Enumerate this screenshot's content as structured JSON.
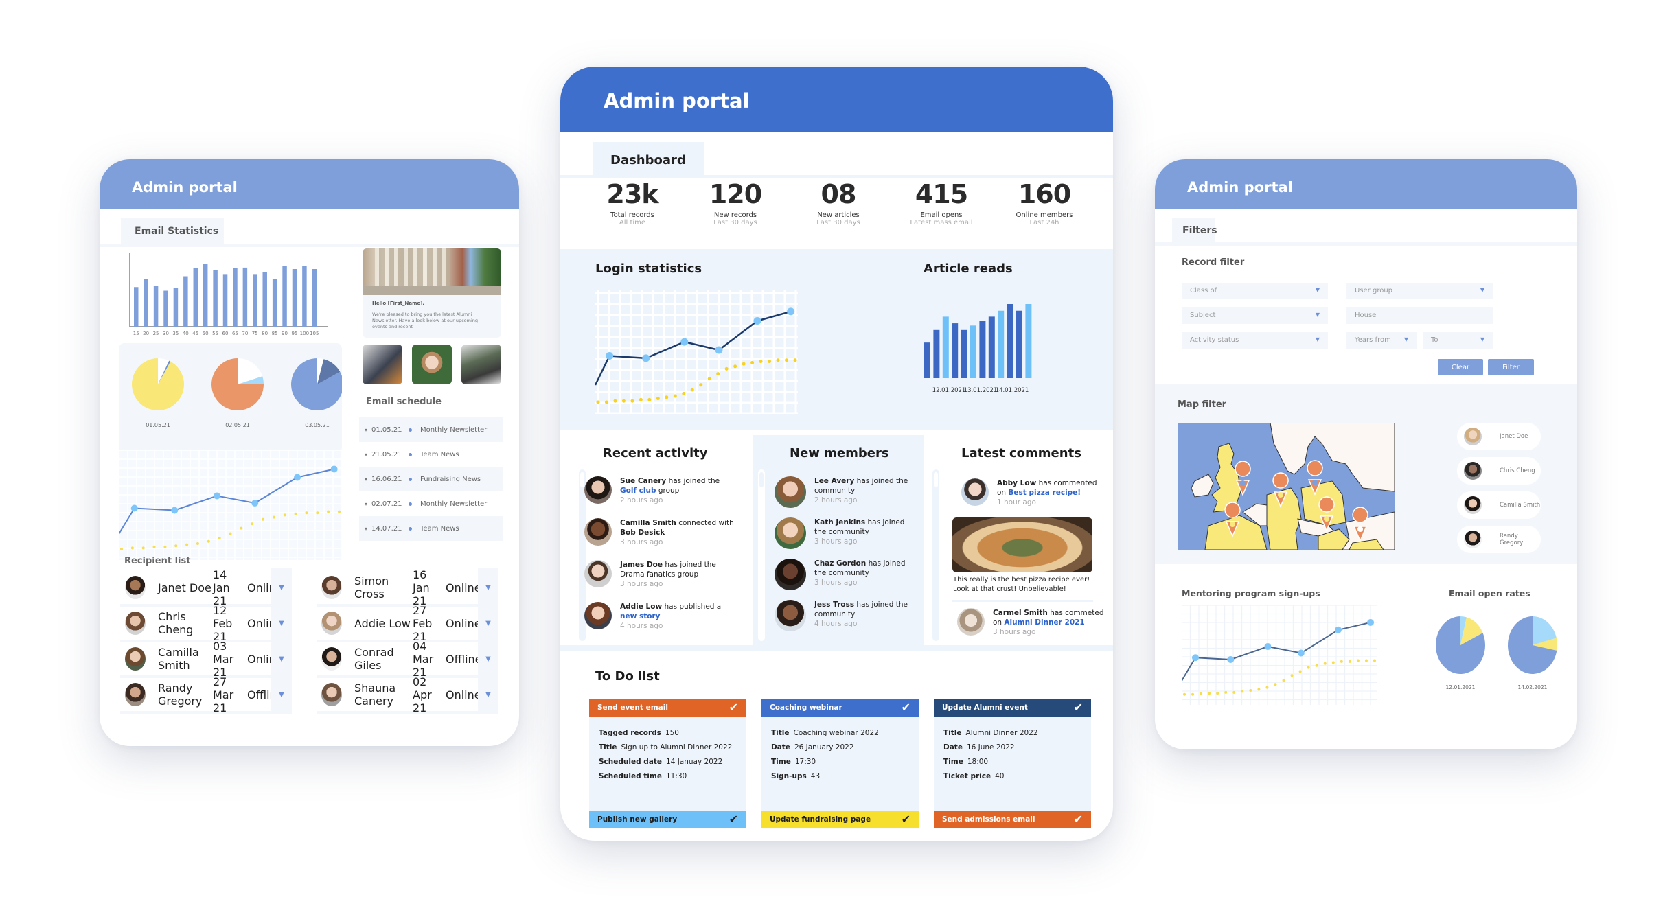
{
  "left": {
    "header_title": "Admin portal",
    "tab": "Email Statistics",
    "bar_chart": {
      "type": "bar",
      "categories": [
        "15",
        "20",
        "25",
        "30",
        "35",
        "40",
        "45",
        "50",
        "55",
        "60",
        "65",
        "70",
        "75",
        "80",
        "85",
        "90",
        "95",
        "100",
        "105"
      ],
      "values": [
        55,
        66,
        57,
        50,
        54,
        70,
        81,
        87,
        79,
        73,
        81,
        82,
        73,
        76,
        66,
        84,
        80,
        84,
        80
      ],
      "ylim": [
        0,
        100
      ]
    },
    "newsletter": {
      "greeting": "Hello [First_Name],",
      "body": "We're pleased to bring you the latest Alumni Newsletter. Have a look below at our upcoming events and recent"
    },
    "pies": [
      {
        "label": "01.05.21",
        "slices": [
          {
            "value": 92,
            "color": "#f9e777"
          },
          {
            "value": 1,
            "color": "#6b8fd8"
          },
          {
            "value": 7,
            "color": "#ffffff"
          }
        ]
      },
      {
        "label": "02.05.21",
        "slices": [
          {
            "value": 75,
            "color": "#ea9668"
          },
          {
            "value": 5,
            "color": "#a6dafa"
          },
          {
            "value": 20,
            "color": "#ffffff"
          }
        ]
      },
      {
        "label": "03.05.21",
        "slices": [
          {
            "value": 83,
            "color": "#7f9fdb"
          },
          {
            "value": 13,
            "color": "#5c77a8"
          },
          {
            "value": 4,
            "color": "#ffffff"
          }
        ]
      }
    ],
    "schedule_title": "Email schedule",
    "schedule": [
      {
        "date": "01.05.21",
        "name": "Monthly Newsletter"
      },
      {
        "date": "21.05.21",
        "name": "Team News"
      },
      {
        "date": "16.06.21",
        "name": "Fundraising News"
      },
      {
        "date": "02.07.21",
        "name": "Monthly Newsletter"
      },
      {
        "date": "14.07.21",
        "name": "Team News"
      }
    ],
    "line_chart": {
      "type": "line",
      "series": [
        {
          "name": "main",
          "values": [
            20,
            45,
            43,
            57,
            50,
            75,
            83
          ],
          "color": "#5b85d6"
        },
        {
          "name": "trend",
          "values": [
            5,
            6,
            6,
            7,
            7,
            8,
            9,
            10,
            12,
            15,
            19,
            24,
            28,
            32,
            34,
            36,
            37,
            38,
            38,
            39,
            39
          ],
          "color": "#f7de4c"
        }
      ]
    },
    "recipient_title": "Recipient list",
    "recipients": [
      {
        "name": "Janet Doe",
        "date": "14 Jan 21",
        "status": "Online"
      },
      {
        "name": "Chris Cheng",
        "date": "12 Feb 21",
        "status": "Online"
      },
      {
        "name": "Camilla Smith",
        "date": "03 Mar 21",
        "status": "Online"
      },
      {
        "name": "Randy Gregory",
        "date": "27 Mar 21",
        "status": "Offline"
      },
      {
        "name": "Simon Cross",
        "date": "16 Jan 21",
        "status": "Online"
      },
      {
        "name": "Addie Low",
        "date": "27 Feb 21",
        "status": "Online"
      },
      {
        "name": "Conrad Giles",
        "date": "04 Mar 21",
        "status": "Offline"
      },
      {
        "name": "Shauna Canery",
        "date": "02 Apr 21",
        "status": "Online"
      }
    ]
  },
  "center": {
    "header_title": "Admin portal",
    "tab": "Dashboard",
    "stats": [
      {
        "value": "23k",
        "label": "Total records",
        "sub": "All time"
      },
      {
        "value": "120",
        "label": "New records",
        "sub": "Last 30 days"
      },
      {
        "value": "08",
        "label": "New articles",
        "sub": "Last 30 days"
      },
      {
        "value": "415",
        "label": "Email opens",
        "sub": "Latest mass email"
      },
      {
        "value": "160",
        "label": "Online members",
        "sub": "Last 24h"
      }
    ],
    "login_title": "Login statistics",
    "login_chart": {
      "type": "line",
      "series": [
        {
          "name": "main",
          "values": [
            20,
            45,
            43,
            57,
            50,
            75,
            83
          ],
          "color": "#1b3a6b"
        },
        {
          "name": "trend",
          "values": [
            5,
            5,
            6,
            6,
            6,
            7,
            7,
            8,
            9,
            10,
            12,
            15,
            19,
            24,
            28,
            32,
            34,
            36,
            37,
            38,
            38,
            39,
            39,
            39
          ],
          "color": "#f7d21e"
        }
      ]
    },
    "article_title": "Article reads",
    "article_chart": {
      "type": "bar",
      "values": [
        48,
        65,
        83,
        74,
        65,
        71,
        77,
        83,
        91,
        100,
        91,
        100
      ],
      "colors": [
        "#3c68c4",
        "#3c68c4",
        "#6ec1f8",
        "#3c68c4",
        "#3c68c4",
        "#6ec1f8",
        "#3c68c4",
        "#3c68c4",
        "#6ec1f8",
        "#3c68c4",
        "#3c68c4",
        "#6ec1f8"
      ],
      "xticks": [
        "12.01.2021",
        "13.01.2021",
        "14.01.2021"
      ],
      "ylim": [
        0,
        100
      ]
    },
    "activity_title": "Recent activity",
    "activity": [
      {
        "name": "Sue Canery",
        "pre": " has joined the ",
        "link": "Golf club",
        "post": " group",
        "ago": "2 hours ago"
      },
      {
        "name": "Camilla Smith",
        "pre": " connected with ",
        "bold2": "Bob Desick",
        "post": "",
        "ago": "3 hours ago"
      },
      {
        "name": "James Doe",
        "pre": " has joined the Drama fanatics group",
        "post": "",
        "ago": "3 hours ago"
      },
      {
        "name": "Addie Low",
        "pre": " has published a ",
        "link": "new story",
        "post": "",
        "ago": "4 hours ago"
      }
    ],
    "members_title": "New members",
    "members": [
      {
        "name": "Lee Avery",
        "text": " has joined the community",
        "ago": "2 hours ago"
      },
      {
        "name": "Kath Jenkins",
        "text": " has joined the community",
        "ago": "3 hours ago"
      },
      {
        "name": "Chaz Gordon",
        "text": " has joined the community",
        "ago": "3 hours ago"
      },
      {
        "name": "Jess Tross",
        "text": " has joined the community",
        "ago": "4 hours ago"
      }
    ],
    "comments_title": "Latest comments",
    "comments": [
      {
        "name": "Abby Low",
        "text": " has commented on ",
        "link": "Best pizza recipe!",
        "ago": "1 hour ago"
      },
      {
        "name": "Carmel Smith",
        "text": " has commeted on ",
        "link": "Alumni Dinner 2021",
        "ago": "3 hours ago"
      }
    ],
    "comment_body": "This really is the best pizza recipe ever! Look at that crust! Unbelievable!",
    "todo_title": "To Do list",
    "todos": [
      {
        "title": "Send event email",
        "color": "#e06426",
        "fields": [
          [
            "Tagged records",
            "150"
          ],
          [
            "Title",
            "Sign up to Alumni Dinner 2022"
          ],
          [
            "Scheduled date",
            "14 Januay 2022"
          ],
          [
            "Scheduled time",
            "11:30"
          ]
        ]
      },
      {
        "title": "Coaching webinar",
        "color": "#3f6fcc",
        "fields": [
          [
            "Title",
            "Coaching webinar 2022"
          ],
          [
            "Date",
            "26 January 2022"
          ],
          [
            "Time",
            "17:30"
          ],
          [
            "Sign-ups",
            "43"
          ]
        ]
      },
      {
        "title": "Update Alumni event",
        "color": "#264a7a",
        "fields": [
          [
            "Title",
            "Alumni Dinner 2022"
          ],
          [
            "Date",
            "16 June 2022"
          ],
          [
            "Time",
            "18:00"
          ],
          [
            "Ticket price",
            "40"
          ]
        ]
      }
    ],
    "todos_small": [
      {
        "title": "Publish new gallery",
        "color": "#6ec1f8",
        "text_color": "#1d1d1d"
      },
      {
        "title": "Update fundraising page",
        "color": "#f7df2e",
        "text_color": "#1d1d1d"
      },
      {
        "title": "Send admissions email",
        "color": "#e06426",
        "text_color": "#ffffff"
      }
    ]
  },
  "right": {
    "header_title": "Admin portal",
    "tab": "Filters",
    "record_filter_title": "Record filter",
    "fields": {
      "class_of": "Class of",
      "user_group": "User group",
      "subject": "Subject",
      "house": "House",
      "activity_status": "Activity status",
      "years_from": "Years from",
      "to": "To"
    },
    "clear_label": "Clear",
    "filter_label": "Filter",
    "map_title": "Map filter",
    "map_people": [
      "Janet Doe",
      "Chris Cheng",
      "Camilla Smith",
      "Randy Gregory"
    ],
    "mentoring_title": "Mentoring program sign-ups",
    "mentoring_chart": {
      "type": "line",
      "series": [
        {
          "name": "main",
          "values": [
            20,
            45,
            43,
            57,
            50,
            75,
            83
          ],
          "color": "#4a6590"
        },
        {
          "name": "trend",
          "values": [
            5,
            5,
            6,
            6,
            6,
            7,
            7,
            8,
            9,
            10,
            12,
            15,
            19,
            24,
            28,
            32,
            34,
            36,
            37,
            38,
            38,
            39,
            39,
            39
          ],
          "color": "#f7de4c"
        }
      ]
    },
    "open_rates_title": "Email open rates",
    "open_pies": [
      {
        "label": "12.01.2021",
        "slices": [
          {
            "value": 82,
            "color": "#7f9fdb"
          },
          {
            "value": 4,
            "color": "#a6dafa"
          },
          {
            "value": 14,
            "color": "#f9e777"
          }
        ]
      },
      {
        "label": "14.02.2021",
        "slices": [
          {
            "value": 72,
            "color": "#7f9fdb"
          },
          {
            "value": 21,
            "color": "#a6dafa"
          },
          {
            "value": 7,
            "color": "#f9e777"
          }
        ]
      }
    ]
  }
}
